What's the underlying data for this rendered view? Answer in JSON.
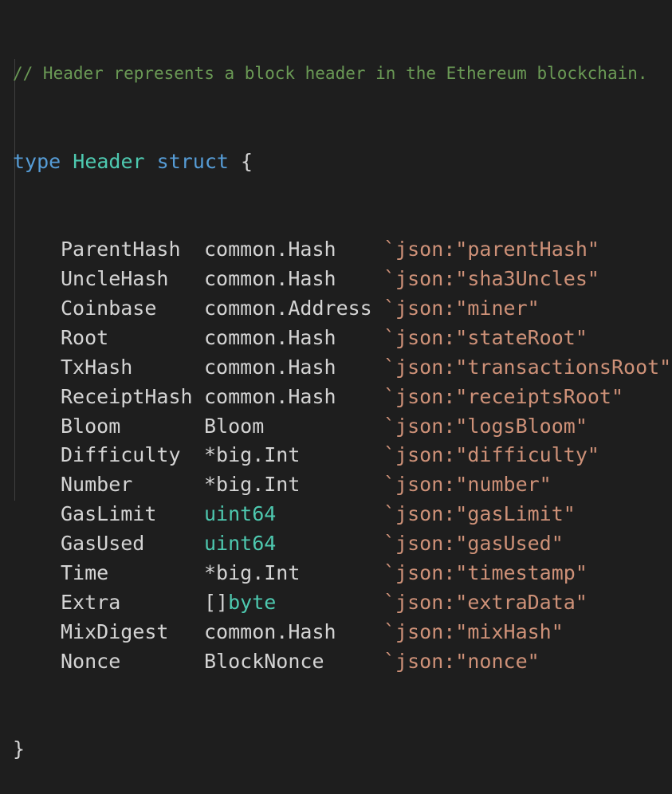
{
  "comment": "// Header represents a block header in the Ethereum blockchain.",
  "decl": {
    "keyword_type": "type",
    "name": "Header",
    "keyword_struct": "struct",
    "open": "{",
    "close": "}"
  },
  "fields": [
    {
      "name": "ParentHash",
      "type_prefix": "",
      "type": "common.Hash",
      "builtin": false,
      "tag": "`json:\"parentHash\""
    },
    {
      "name": "UncleHash",
      "type_prefix": "",
      "type": "common.Hash",
      "builtin": false,
      "tag": "`json:\"sha3Uncles\""
    },
    {
      "name": "Coinbase",
      "type_prefix": "",
      "type": "common.Address",
      "builtin": false,
      "tag": "`json:\"miner\""
    },
    {
      "name": "Root",
      "type_prefix": "",
      "type": "common.Hash",
      "builtin": false,
      "tag": "`json:\"stateRoot\""
    },
    {
      "name": "TxHash",
      "type_prefix": "",
      "type": "common.Hash",
      "builtin": false,
      "tag": "`json:\"transactionsRoot\""
    },
    {
      "name": "ReceiptHash",
      "type_prefix": "",
      "type": "common.Hash",
      "builtin": false,
      "tag": "`json:\"receiptsRoot\""
    },
    {
      "name": "Bloom",
      "type_prefix": "",
      "type": "Bloom",
      "builtin": false,
      "tag": "`json:\"logsBloom\""
    },
    {
      "name": "Difficulty",
      "type_prefix": "",
      "type": "*big.Int",
      "builtin": false,
      "tag": "`json:\"difficulty\""
    },
    {
      "name": "Number",
      "type_prefix": "",
      "type": "*big.Int",
      "builtin": false,
      "tag": "`json:\"number\""
    },
    {
      "name": "GasLimit",
      "type_prefix": "",
      "type": "uint64",
      "builtin": true,
      "tag": "`json:\"gasLimit\""
    },
    {
      "name": "GasUsed",
      "type_prefix": "",
      "type": "uint64",
      "builtin": true,
      "tag": "`json:\"gasUsed\""
    },
    {
      "name": "Time",
      "type_prefix": "",
      "type": "*big.Int",
      "builtin": false,
      "tag": "`json:\"timestamp\""
    },
    {
      "name": "Extra",
      "type_prefix": "[]",
      "type": "byte",
      "builtin": true,
      "tag": "`json:\"extraData\""
    },
    {
      "name": "MixDigest",
      "type_prefix": "",
      "type": "common.Hash",
      "builtin": false,
      "tag": "`json:\"mixHash\""
    },
    {
      "name": "Nonce",
      "type_prefix": "",
      "type": "BlockNonce",
      "builtin": false,
      "tag": "`json:\"nonce\""
    }
  ]
}
